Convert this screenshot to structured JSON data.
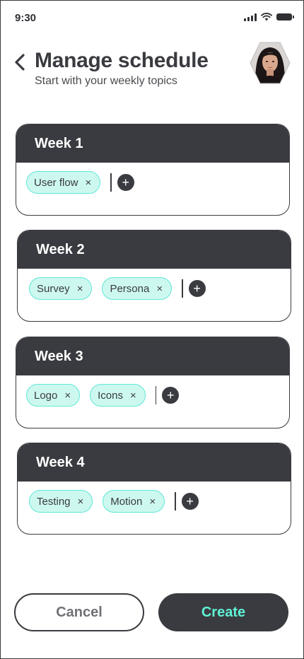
{
  "status_bar": {
    "time": "9:30"
  },
  "header": {
    "title": "Manage schedule",
    "subtitle": "Start with your weekly topics"
  },
  "weeks": [
    {
      "title": "Week 1",
      "tags": [
        "User flow"
      ]
    },
    {
      "title": "Week 2",
      "tags": [
        "Survey",
        "Persona"
      ]
    },
    {
      "title": "Week 3",
      "tags": [
        "Logo",
        "Icons"
      ]
    },
    {
      "title": "Week 4",
      "tags": [
        "Testing",
        "Motion"
      ]
    }
  ],
  "tag_remove_glyph": "×",
  "add_glyph": "+",
  "actions": {
    "cancel_label": "Cancel",
    "create_label": "Create"
  },
  "colors": {
    "dark": "#3a3b40",
    "tag_fill": "#cdf8f0",
    "tag_border": "#5ee8d6",
    "accent": "#5ff2d6"
  }
}
